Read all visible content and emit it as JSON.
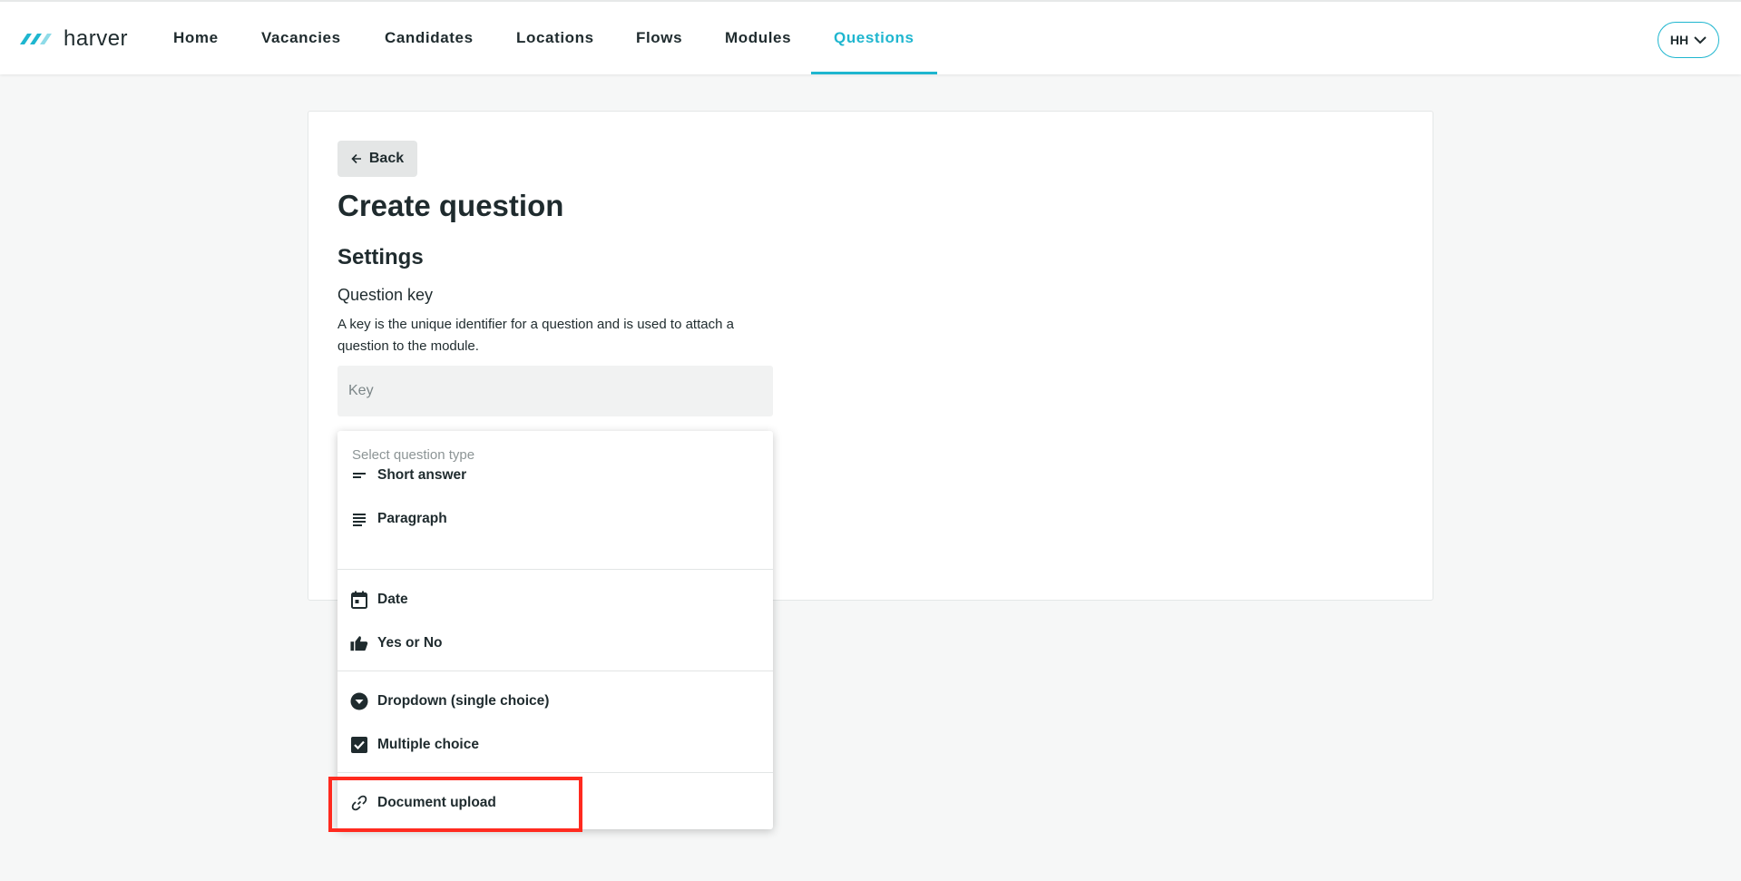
{
  "app": {
    "logo_text": "harver",
    "accent_color": "#1fb6cf",
    "highlight_color": "#ff2a1f"
  },
  "nav": {
    "items": [
      {
        "label": "Home",
        "active": false
      },
      {
        "label": "Vacancies",
        "active": false
      },
      {
        "label": "Candidates",
        "active": false
      },
      {
        "label": "Locations",
        "active": false
      },
      {
        "label": "Flows",
        "active": false
      },
      {
        "label": "Modules",
        "active": false
      },
      {
        "label": "Questions",
        "active": true
      }
    ]
  },
  "user": {
    "initials": "HH"
  },
  "page": {
    "back_label": "Back",
    "title": "Create question",
    "section_title": "Settings",
    "key_label": "Question key",
    "key_description": "A key is the unique identifier for a question and is used to attach a question to the module.",
    "key_placeholder": "Key",
    "key_value": ""
  },
  "question_type_menu": {
    "header": "Select question type",
    "options": [
      {
        "label": "Short answer",
        "icon": "short-text-icon"
      },
      {
        "label": "Paragraph",
        "icon": "paragraph-icon"
      },
      {
        "label": "Date",
        "icon": "calendar-icon"
      },
      {
        "label": "Yes or No",
        "icon": "thumbs-up-icon"
      },
      {
        "label": "Dropdown (single choice)",
        "icon": "dropdown-circle-icon"
      },
      {
        "label": "Multiple choice",
        "icon": "checkbox-icon"
      },
      {
        "label": "Document upload",
        "icon": "link-icon",
        "highlighted": true
      }
    ]
  }
}
